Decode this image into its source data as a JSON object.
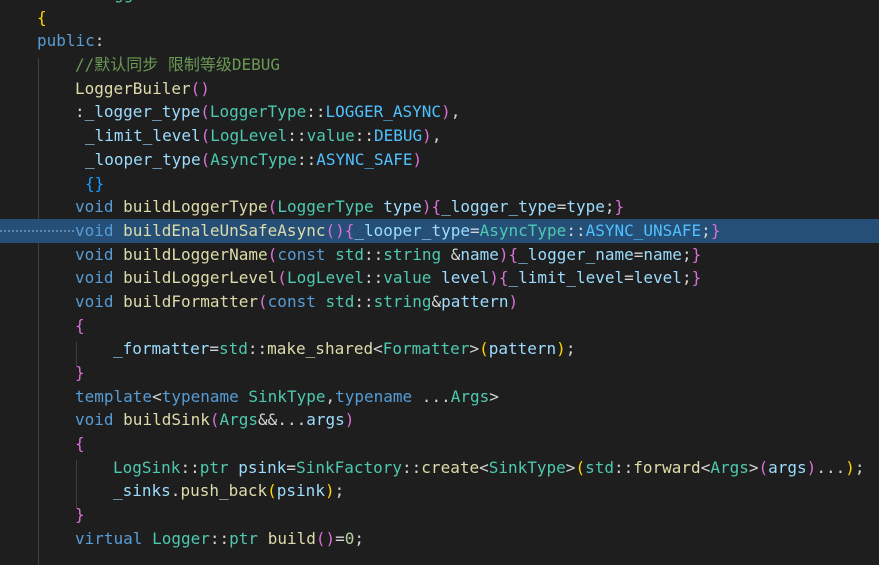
{
  "editor": {
    "language": "cpp",
    "theme_colors": {
      "background": "#1e1e1e",
      "keyword": "#569cd6",
      "type": "#4ec9b0",
      "function": "#dcdcaa",
      "member": "#9cdcfe",
      "comment": "#6a9955",
      "selection": "#264f78"
    },
    "highlighted_line_index": 10,
    "lines": [
      "class LoggerBuiler",
      "{",
      "public:",
      "    //默认同步 限制等级DEBUG",
      "    LoggerBuiler()",
      "    :_logger_type(LoggerType::LOGGER_ASYNC),",
      "     _limit_level(LogLevel::value::DEBUG),",
      "     _looper_type(AsyncType::ASYNC_SAFE)",
      "     {}",
      "    void buildLoggerType(LoggerType type){_logger_type=type;}",
      "    void buildEnaleUnSafeAsync(){_looper_type=AsyncType::ASYNC_UNSAFE;}",
      "    void buildLoggerName(const std::string &name){_logger_name=name;}",
      "    void buildLoggerLevel(LogLevel::value level){_limit_level=level;}",
      "    void buildFormatter(const std::string&pattern)",
      "    {",
      "        _formatter=std::make_shared<Formatter>(pattern);",
      "    }",
      "    template<typename SinkType,typename ...Args>",
      "    void buildSink(Args&&...args)",
      "    {",
      "        LogSink::ptr psink=SinkFactory::create<SinkType>(std::forward<Args>(args)...);",
      "        _sinks.push_back(psink);",
      "    }",
      "    virtual Logger::ptr build()=0;"
    ]
  }
}
